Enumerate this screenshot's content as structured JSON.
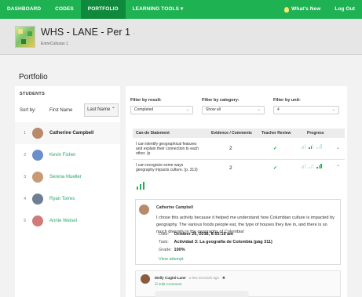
{
  "nav": {
    "items": [
      "DASHBOARD",
      "CODES",
      "PORTFOLIO",
      "LEARNING TOOLS ▾"
    ],
    "active": "PORTFOLIO",
    "whats_new": "What's New",
    "logout": "Log Out"
  },
  "course": {
    "title": "WHS - LANE - Per 1",
    "title_suffix": "·",
    "subtitle": "EntreCulturas 1"
  },
  "page": {
    "title": "Portfolio"
  },
  "students": {
    "heading": "STUDENTS",
    "sort_by": "Sort by:",
    "sort_first": "First Name",
    "sort_last": "Last Name ⌃",
    "list": [
      {
        "num": "1",
        "name": "Catherine Campbell",
        "color": "#b98a6a"
      },
      {
        "num": "2",
        "name": "Kevin Fisher",
        "color": "#6b8fc9"
      },
      {
        "num": "3",
        "name": "Serena Mueller",
        "color": "#c99a74"
      },
      {
        "num": "4",
        "name": "Ryan Torres",
        "color": "#6f7e93"
      },
      {
        "num": "5",
        "name": "Annie Weisel",
        "color": "#d07a7a"
      }
    ]
  },
  "filters": {
    "result": {
      "label": "Filter by result:",
      "value": "Completed"
    },
    "category": {
      "label": "Filter by category:",
      "value": "Show all"
    },
    "unit": {
      "label": "Filter by unit:",
      "value": "4"
    }
  },
  "table": {
    "headers": {
      "statement": "Can-do Statement",
      "evidence": "Evidence / Comments",
      "review": "Teacher Review",
      "progress": "Progress"
    },
    "rows": [
      {
        "statement": "I can identify geographical features and explain their connection to each other. (p",
        "count": "2",
        "review_mark": "✔",
        "expand": "⌄"
      },
      {
        "statement": "I can recognize some ways geography impacts culture. (p. 313)",
        "count": "2",
        "review_mark": "✔",
        "expand": "⌃"
      }
    ]
  },
  "attempt": {
    "student": "Catherine Campbell",
    "text": "I chose this activity because it helped me understand how Columbian culture is impacted by geography. The various foods people eat, the type of houses they live in, and there is so much diversity in the geography of Colombia!",
    "date_label": "Date:",
    "date": "October 26, 2018, 8:53:19 am",
    "task_label": "Task:",
    "task": "Actividad 3: La geografía de Colombia (pág 311)",
    "grade_label": "Grade:",
    "grade": "100%",
    "view_attempt": "View attempt"
  },
  "comment": {
    "author": "Molly Cugini-Lane",
    "time": "· a few seconds ago ·",
    "delete": "✖",
    "edit": "☑ Edit Comment"
  },
  "colors": {
    "brand": "#1eb253",
    "brand_dark": "#0f8a3c",
    "link": "#2aa66a"
  }
}
